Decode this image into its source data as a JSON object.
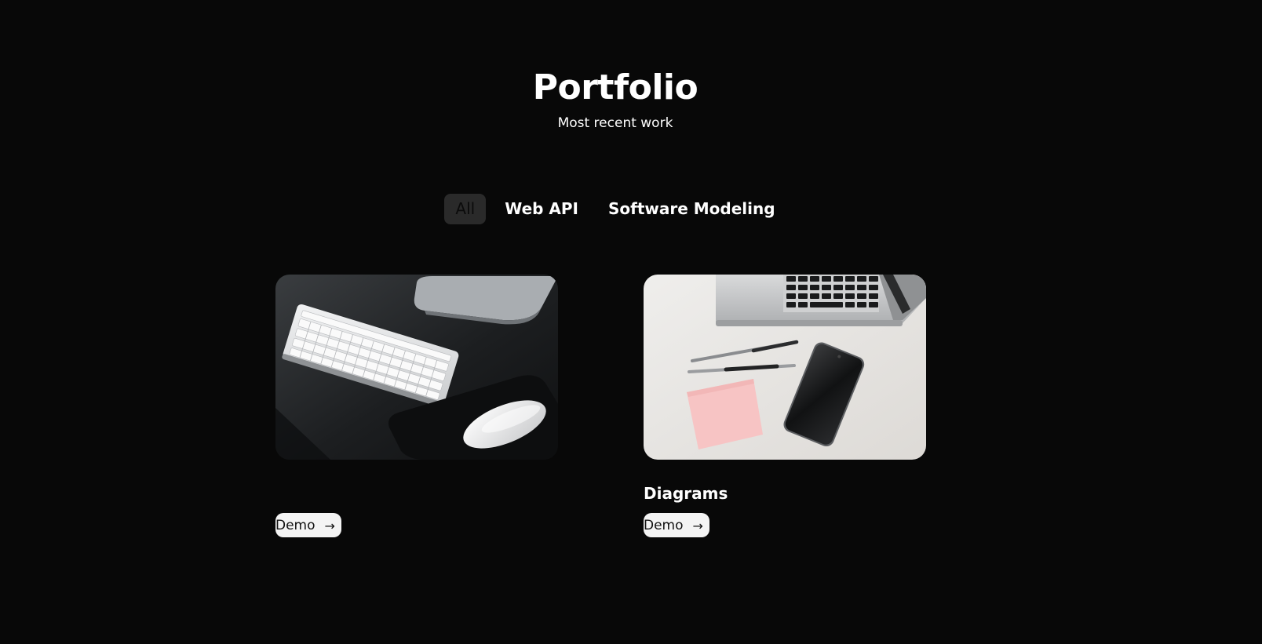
{
  "header": {
    "title": "Portfolio",
    "subtitle": "Most recent work"
  },
  "filters": [
    {
      "label": "All",
      "active": true
    },
    {
      "label": "Web API",
      "active": false
    },
    {
      "label": "Software Modeling",
      "active": false
    }
  ],
  "projects": [
    {
      "title": "",
      "button_label": "Demo",
      "image": "keyboard-mouse-desk-photo"
    },
    {
      "title": "Diagrams",
      "button_label": "Demo",
      "image": "laptop-phone-pens-desk-photo"
    }
  ],
  "icons": {
    "demo_arrow": "→"
  },
  "colors": {
    "background": "#080808",
    "text": "#ffffff",
    "active_filter_bg": "#2a2a2a",
    "button_bg": "#f4f4f4"
  }
}
